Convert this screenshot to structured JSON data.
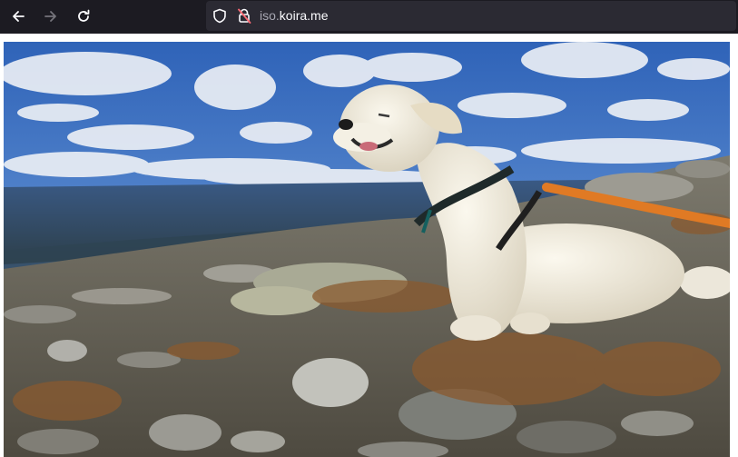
{
  "browser": {
    "url_prefix": "iso.",
    "url_domain": "koira.me",
    "icons": [
      "back-arrow-icon",
      "forward-arrow-icon",
      "reload-icon",
      "shield-icon",
      "insecure-lock-icon"
    ],
    "colors": {
      "toolbar": "#1c1b22",
      "urlbar": "#2b2a33",
      "url_text": "#fbfbfe",
      "url_dim": "#a8a8b3"
    }
  },
  "content": {
    "image_subject": "white-dog-on-rocky-fell"
  }
}
